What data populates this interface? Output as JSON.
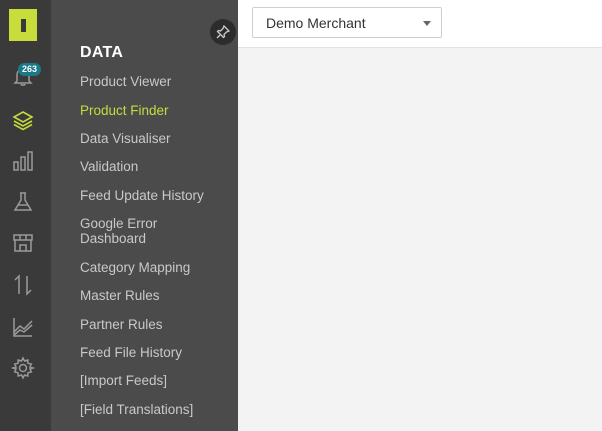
{
  "notifications": {
    "count": "263"
  },
  "rail": {
    "icons": [
      "logo-icon",
      "bell-icon",
      "layers-icon",
      "bar-chart-icon",
      "flask-icon",
      "store-icon",
      "transfer-icon",
      "line-chart-icon",
      "gear-icon"
    ]
  },
  "panel": {
    "title": "DATA",
    "items": [
      {
        "label": "Product Viewer"
      },
      {
        "label": "Product Finder"
      },
      {
        "label": "Data Visualiser"
      },
      {
        "label": "Validation"
      },
      {
        "label": "Feed Update History"
      },
      {
        "label": "Google Error Dashboard"
      },
      {
        "label": "Category Mapping"
      },
      {
        "label": "Master Rules"
      },
      {
        "label": "Partner Rules"
      },
      {
        "label": "Feed File History"
      },
      {
        "label": "[Import Feeds]"
      },
      {
        "label": "[Field Translations]"
      }
    ]
  },
  "merchant_select": {
    "value": "Demo Merchant"
  },
  "colors": {
    "accent": "#c8dc3c",
    "badge": "#1a7a86",
    "rail_bg": "#3a3a3a",
    "panel_bg": "#4b4b4b"
  }
}
